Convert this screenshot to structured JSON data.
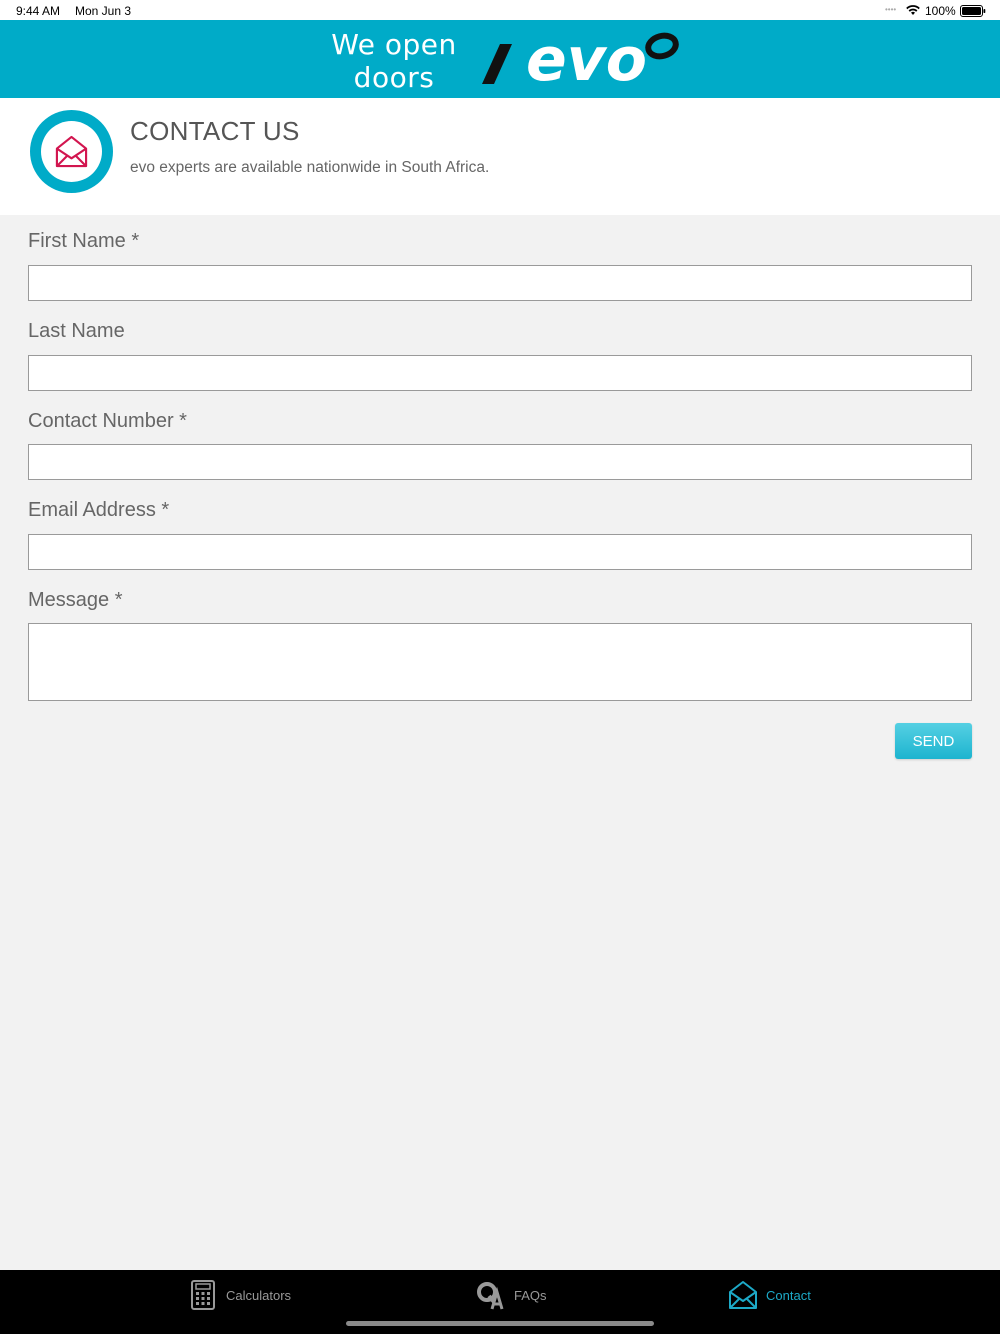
{
  "status_bar": {
    "time": "9:44 AM",
    "date": "Mon Jun 3",
    "battery": "100%"
  },
  "header": {
    "tagline": "We open doors",
    "logo_text": "evo",
    "color": "#00abc8"
  },
  "contact": {
    "title": "CONTACT US",
    "subtitle": "evo experts are available nationwide in South Africa.",
    "icon": "envelope-icon"
  },
  "form": {
    "fields": [
      {
        "label": "First Name *",
        "value": ""
      },
      {
        "label": "Last Name",
        "value": ""
      },
      {
        "label": "Contact Number *",
        "value": ""
      },
      {
        "label": "Email Address *",
        "value": ""
      },
      {
        "label": "Message *",
        "value": ""
      }
    ],
    "send_label": "SEND"
  },
  "tabs": [
    {
      "label": "Calculators",
      "icon": "calculator-icon",
      "active": false
    },
    {
      "label": "FAQs",
      "icon": "qa-icon",
      "active": false
    },
    {
      "label": "Contact",
      "icon": "envelope-icon",
      "active": true
    }
  ],
  "colors": {
    "accent": "#00abc8",
    "envelope": "#d2154f",
    "active_tab": "#1da9c7"
  }
}
